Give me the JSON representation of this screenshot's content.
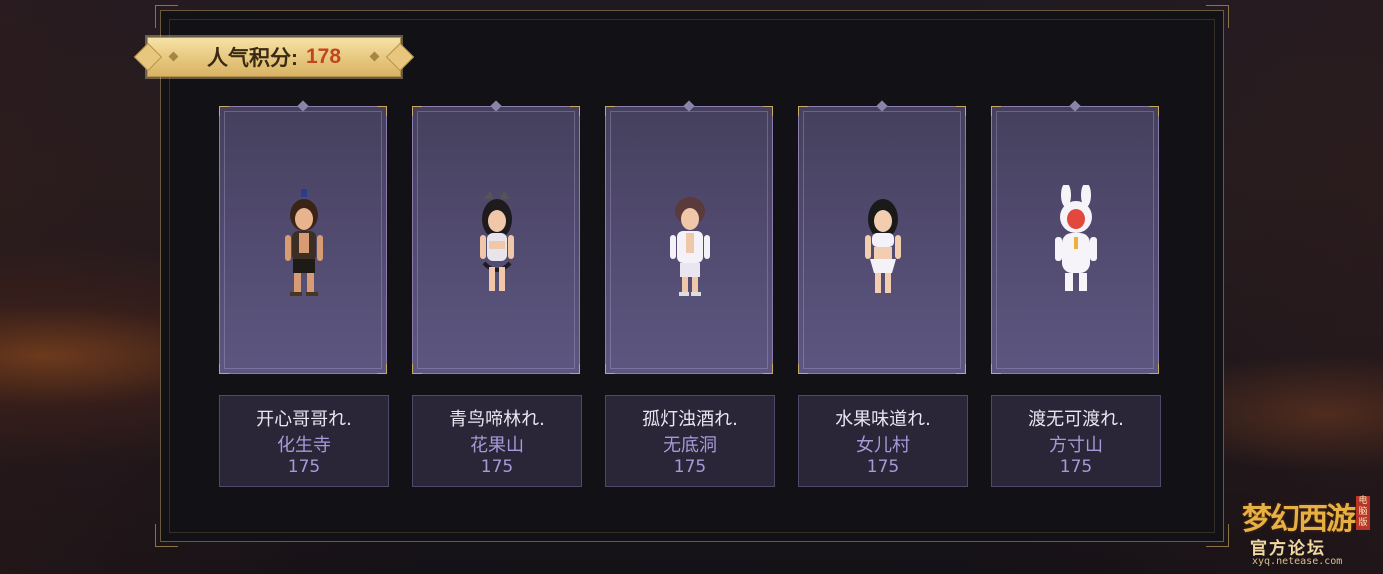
{
  "score": {
    "label": "人气积分:",
    "value": "178"
  },
  "players": [
    {
      "name": "开心哥哥れ.",
      "school": "化生寺",
      "points": "175"
    },
    {
      "name": "青鸟啼林れ.",
      "school": "花果山",
      "points": "175"
    },
    {
      "name": "孤灯浊酒れ.",
      "school": "无底洞",
      "points": "175"
    },
    {
      "name": "水果味道れ.",
      "school": "女儿村",
      "points": "175"
    },
    {
      "name": "渡无可渡れ.",
      "school": "方寸山",
      "points": "175"
    }
  ],
  "logo": {
    "title": "梦幻西游",
    "badge": "电脑版",
    "subtitle": "官方论坛",
    "url": "xyq.netease.com"
  },
  "colors": {
    "accent_gold": "#e6c77d",
    "score_value": "#c1461f",
    "school_text": "#a69ad8",
    "card_bg": "#524b70"
  }
}
